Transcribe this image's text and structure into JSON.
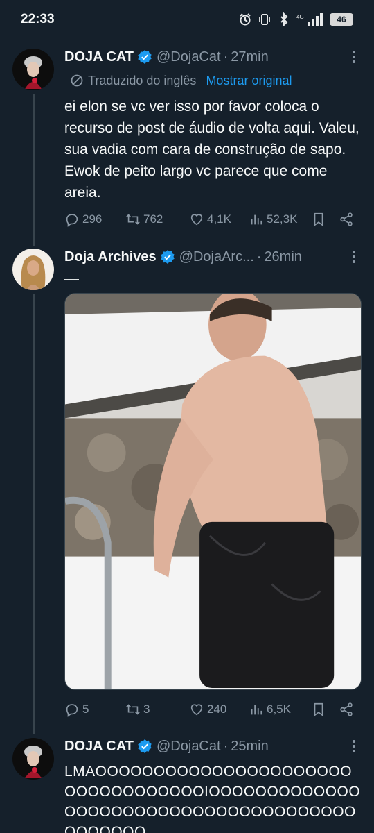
{
  "status_bar": {
    "time": "22:33",
    "battery": "46",
    "network": "4G"
  },
  "tweets": [
    {
      "name": "DOJA CAT",
      "handle": "@DojaCat",
      "time": "27min",
      "translation": {
        "label": "Traduzido do inglês",
        "link": "Mostrar original"
      },
      "text": "ei elon se vc ver isso por favor coloca o recurso de post de áudio de volta aqui. Valeu, sua vadia com cara de construção de sapo. Ewok de peito largo vc parece que come areia.",
      "replies": "296",
      "retweets": "762",
      "likes": "4,1K",
      "views": "52,3K"
    },
    {
      "name": "Doja Archives",
      "handle": "@DojaArc...",
      "time": "26min",
      "text": "—",
      "replies": "5",
      "retweets": "3",
      "likes": "240",
      "views": "6,5K"
    },
    {
      "name": "DOJA CAT",
      "handle": "@DojaCat",
      "time": "25min",
      "text": "LMAOOOOOOOOOOOOOOOOOOOOOOOOOOOOOOOOOOIOOOOOOOOOOOOOOOOOOOOOOOOOOOOOOOOOOOOOOOOOOOOO"
    }
  ],
  "colors": {
    "background": "#15202b",
    "accent": "#1d9bf0",
    "muted": "#8b98a5",
    "text": "#f7f9f9"
  },
  "icons": [
    "alarm-icon",
    "vibrate-icon",
    "bluetooth-icon",
    "signal-icon",
    "battery-icon",
    "verified-badge-icon",
    "more-icon",
    "translate-globe-icon",
    "reply-icon",
    "retweet-icon",
    "like-icon",
    "views-icon",
    "bookmark-icon",
    "share-icon"
  ]
}
